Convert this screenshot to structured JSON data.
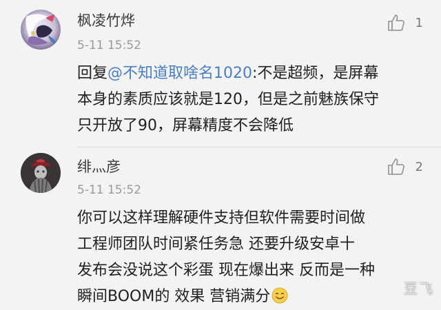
{
  "comments": [
    {
      "username": "枫凌竹烨",
      "timestamp": "5-11 15:52",
      "likes": "1",
      "reply_prefix": "回复",
      "mention": "@不知道取啥名1020",
      "text_lines": [
        ":不是超频，是屏幕",
        "本身的素质应该就是120，但是之前魅族保守",
        "只开放了90，屏幕精度不会降低"
      ],
      "avatar_icon": "anime-avatar-icon"
    },
    {
      "username": "绯灬彦",
      "timestamp": "5-11 15:52",
      "likes": "2",
      "text_lines": [
        "你可以这样理解硬件支持但软件需要时间做",
        "工程师团队时间紧任务急  还要升级安卓十",
        "发布会没说这个彩蛋  现在爆出来  反而是一种",
        "瞬间BOOM的 效果  营销满分"
      ],
      "emoji": "smiley-emoji-icon",
      "avatar_icon": "figure-avatar-icon"
    }
  ],
  "watermark": "豆飞",
  "colors": {
    "background": "#f3f3f3",
    "mention": "#4a7fbf",
    "username": "#3b3b3b",
    "timestamp": "#9a9a9a",
    "body": "#1f1f1f"
  }
}
